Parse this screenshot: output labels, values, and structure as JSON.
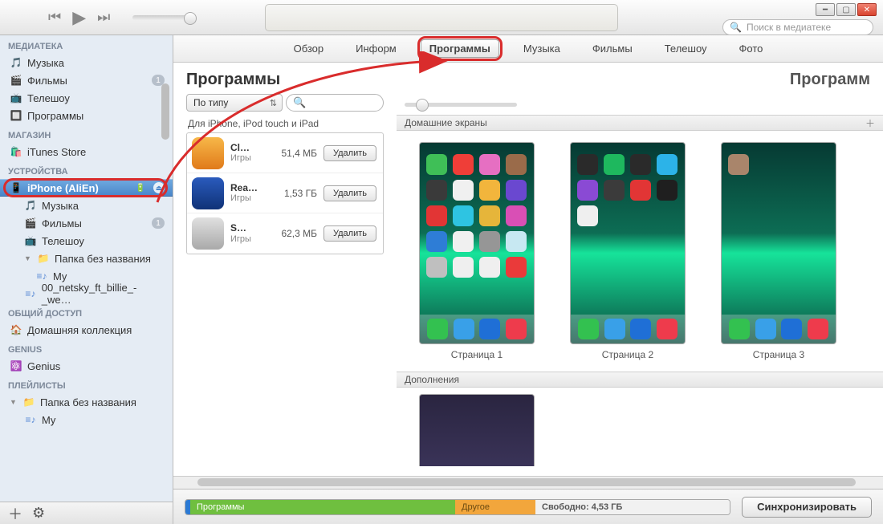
{
  "search_placeholder": "Поиск в медиатеке",
  "sidebar": {
    "library_head": "МЕДИАТЕКА",
    "music": "Музыка",
    "movies": "Фильмы",
    "movies_badge": "1",
    "tvshows": "Телешоу",
    "apps": "Программы",
    "store_head": "МАГАЗИН",
    "itunes_store": "iTunes Store",
    "devices_head": "УСТРОЙСТВА",
    "device_name": "iPhone (AliEn)",
    "dev_music": "Музыка",
    "dev_movies": "Фильмы",
    "dev_movies_badge": "1",
    "dev_tvshows": "Телешоу",
    "dev_folder": "Папка без названия",
    "dev_pl_my": "My",
    "dev_pl_netsky": "00_netsky_ft_billie_-_we…",
    "shared_head": "ОБЩИЙ ДОСТУП",
    "home_share": "Домашняя коллекция",
    "genius_head": "GENIUS",
    "genius": "Genius",
    "playlists_head": "ПЛЕЙЛИСТЫ",
    "pl_folder": "Папка без названия",
    "pl_my": "My"
  },
  "tabs": {
    "overview": "Обзор",
    "info": "Информ",
    "apps": "Программы",
    "music": "Музыка",
    "movies": "Фильмы",
    "tvshows": "Телешоу",
    "photos": "Фото"
  },
  "title_left": "Программы",
  "title_right": "Программ",
  "apps_pane": {
    "sort": "По типу",
    "section": "Для iPhone, iPod touch и iPad",
    "delete": "Удалить",
    "items": [
      {
        "name": "Cl…",
        "genre": "Игры",
        "size": "51,4 МБ"
      },
      {
        "name": "Rea…",
        "genre": "Игры",
        "size": "1,53 ГБ"
      },
      {
        "name": "S…",
        "genre": "Игры",
        "size": "62,3 МБ"
      }
    ]
  },
  "screens": {
    "home_head": "Домашние экраны",
    "extras_head": "Дополнения",
    "page1": "Страница 1",
    "page2": "Страница 2",
    "page3": "Страница 3"
  },
  "capacity": {
    "apps": "Программы",
    "other": "Другое",
    "free": "Свободно: 4,53 ГБ"
  },
  "sync": "Синхронизировать"
}
